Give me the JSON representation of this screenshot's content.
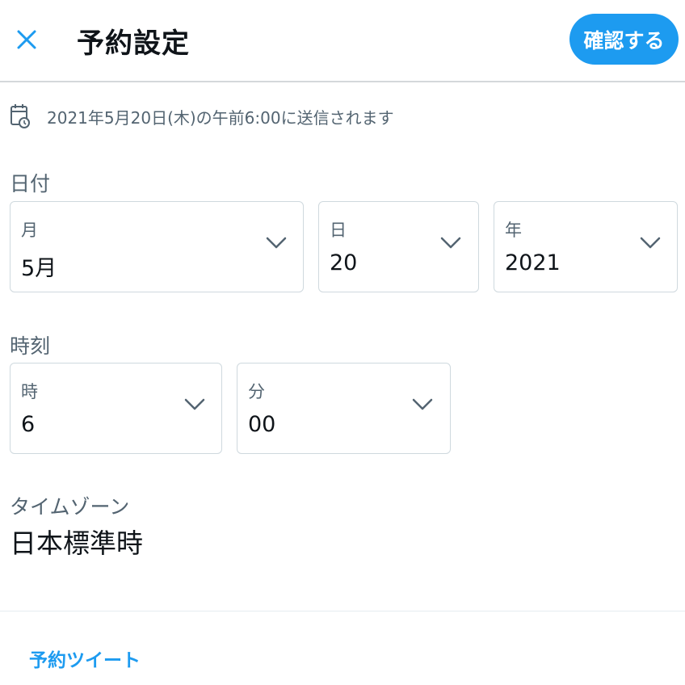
{
  "header": {
    "title": "予約設定",
    "confirm_label": "確認する",
    "close_icon": "close-icon"
  },
  "schedule_info": {
    "text": "2021年5月20日(木)の午前6:00に送信されます",
    "icon": "calendar-clock-icon"
  },
  "date": {
    "label": "日付",
    "month": {
      "label": "月",
      "value": "5月"
    },
    "day": {
      "label": "日",
      "value": "20"
    },
    "year": {
      "label": "年",
      "value": "2021"
    }
  },
  "time": {
    "label": "時刻",
    "hour": {
      "label": "時",
      "value": "6"
    },
    "minute": {
      "label": "分",
      "value": "00"
    }
  },
  "timezone": {
    "label": "タイムゾーン",
    "value": "日本標準時"
  },
  "footer": {
    "scheduled_tweets_link": "予約ツイート"
  },
  "colors": {
    "accent": "#1d9bf0",
    "text_primary": "#0f1419",
    "text_secondary": "#536471",
    "border": "#cfd9de"
  }
}
